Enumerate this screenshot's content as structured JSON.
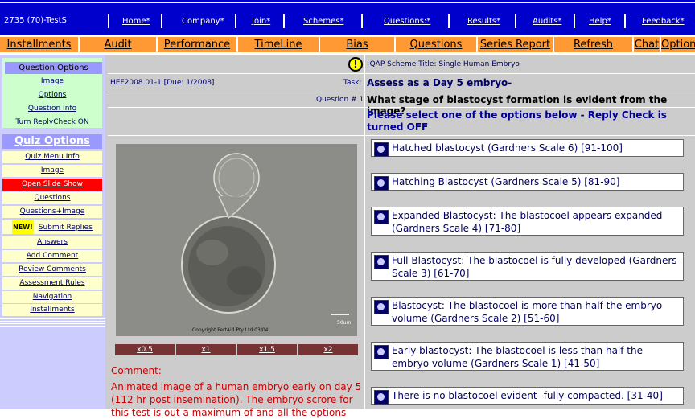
{
  "user": "2735 (70)-TestS",
  "top_nav": [
    "Home*",
    "Company*",
    "Join*",
    "Schemes*",
    "Questions:*",
    "Results*",
    "Audits*",
    "Help*",
    "Feedback*"
  ],
  "tabs": [
    "Installments",
    "Audit",
    "Performance",
    "TimeLine",
    "Bias",
    "Questions",
    "Series Report",
    "Refresh",
    "Chat",
    "Options"
  ],
  "question_options": {
    "title": "Question Options",
    "items": [
      "Image",
      "Options",
      "Question Info",
      "Turn ReplyCheck ON"
    ]
  },
  "quiz_options": {
    "title": "Quiz Options",
    "items": [
      "Quiz Menu Info",
      "Image",
      "Open Slide Show",
      "Questions",
      "Questions+Image",
      "Submit Replies",
      "Answers",
      "Add Comment",
      "Review Comments",
      "Assessment Rules",
      "Navigation",
      "Installments"
    ],
    "new_badge": "NEW!"
  },
  "scheme_title": "-QAP Scheme Title: Single Human Embryo",
  "hef": "HEF2008.01-1 [Due: 1/2008]",
  "task_label": "Task:",
  "task": "Assess as a Day 5 embryo-",
  "question_label": "Question # 1",
  "question": "What stage of blastocyst formation is evident from the image?",
  "instruction": "Please select one of the options below - Reply Check is turned OFF",
  "image": {
    "copyright": "Copyright FertAid Pty Ltd 03/04",
    "scale": "50um"
  },
  "zoom": [
    "x0.5",
    "x1",
    "x1.5",
    "x2"
  ],
  "comment_label": "Comment:",
  "comment": "Animated image of a human embryo early on day 5 (112 hr post insemination). The embryo scrore for this test is out a maximum of and all the options",
  "options": [
    "Hatched blastocyst (Gardners Scale 6) [91-100]",
    "Hatching Blastocyst (Gardners Scale 5) [81-90]",
    "Expanded Blastocyst: The blastocoel appears expanded (Gardners Scale 4) [71-80]",
    "Full Blastocyst: The blastocoel is fully developed (Gardners Scale 3) [61-70]",
    "Blastocyst: The blastocoel is more than half the embryo volume (Gardners Scale 2) [51-60]",
    "Early blastocyst: The blastocoel is less than half the embryo volume (Gardners Scale 1) [41-50]",
    "There is no blastocoel evident- fully compacted. [31-40]"
  ]
}
